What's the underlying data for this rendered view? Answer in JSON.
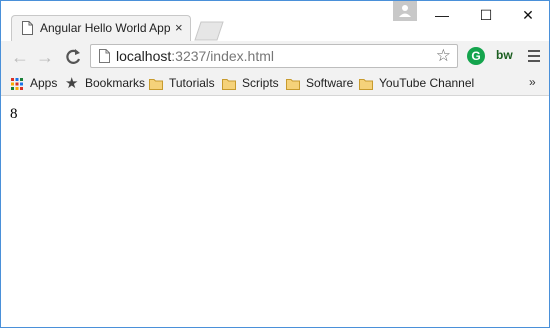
{
  "tab": {
    "title": "Angular Hello World Appli",
    "close_label": "×"
  },
  "window_controls": {
    "minimize": "—",
    "maximize": "☐",
    "close": "✕"
  },
  "address_bar": {
    "host": "localhost",
    "rest": ":3237/index.html"
  },
  "extensions": {
    "grammarly": "G",
    "bw": "bw"
  },
  "bookmarks": {
    "apps": "Apps",
    "items": [
      "Bookmarks",
      "Tutorials",
      "Scripts",
      "Software",
      "YouTube Channel"
    ],
    "more": "»"
  },
  "page": {
    "output": "8"
  },
  "colors": {
    "grammarly": "#14a44d",
    "window_border": "#4a90d9",
    "folder": "#e8b74a"
  }
}
